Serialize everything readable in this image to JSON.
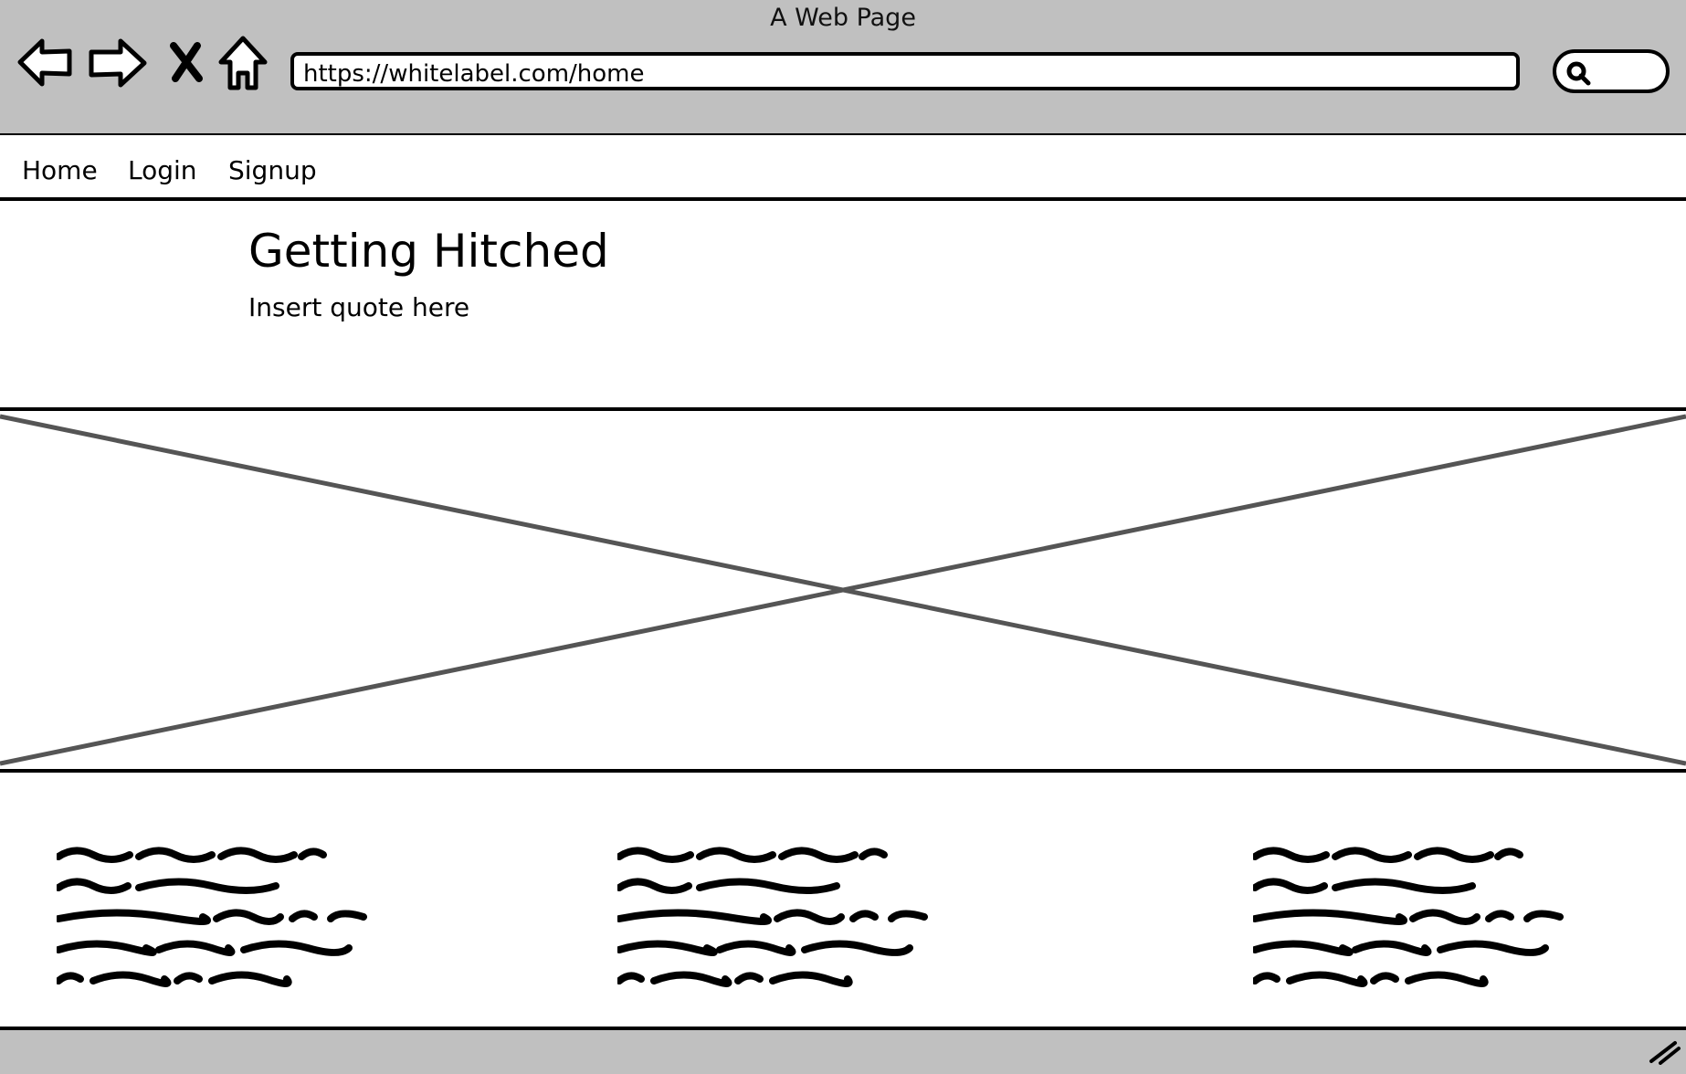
{
  "window": {
    "title": "A Web Page"
  },
  "browser": {
    "url": "https://whitelabel.com/home",
    "icons": [
      "back-arrow-icon",
      "forward-arrow-icon",
      "close-x-icon",
      "home-icon",
      "search-icon"
    ]
  },
  "menu": {
    "items": [
      "Home",
      "Login",
      "Signup"
    ]
  },
  "hero": {
    "title": "Getting Hitched",
    "quote": "Insert quote here"
  },
  "placeholder_image": {
    "type": "image-placeholder"
  },
  "text_columns": {
    "count": 3,
    "lines_per_column": 5,
    "content": "placeholder-scribble"
  }
}
